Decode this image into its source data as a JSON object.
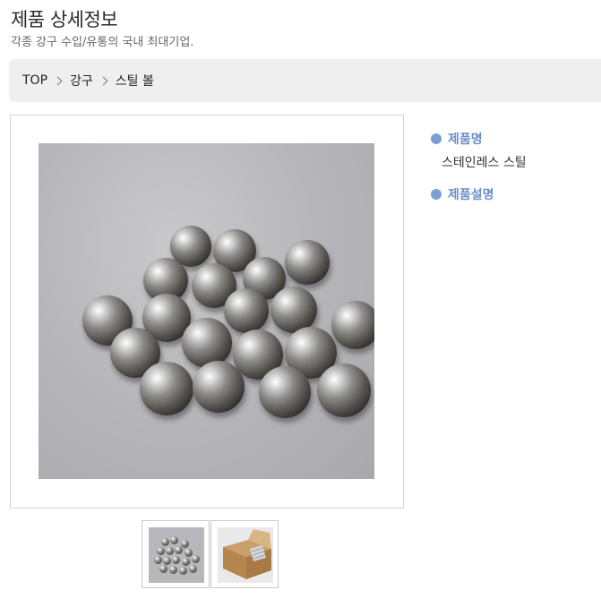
{
  "header": {
    "title": "제품 상세정보",
    "subtitle": "각종 강구 수입/유통의 국내 최대기업."
  },
  "breadcrumb": {
    "items": [
      "TOP",
      "강구",
      "스틸 볼"
    ]
  },
  "product": {
    "name_label": "제품명",
    "name_value": "스테인레스 스틸",
    "desc_label": "제품설명"
  },
  "colors": {
    "accent": "#6b8fc8",
    "bullet": "#7c9fd3",
    "breadcrumb_bg": "#efefef"
  },
  "icons": {
    "separator": "chevron-right-icon",
    "bullet": "circle-bullet-icon"
  }
}
